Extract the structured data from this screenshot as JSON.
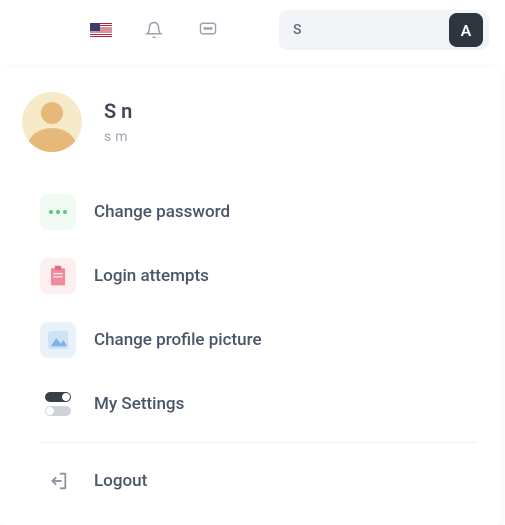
{
  "topbar": {
    "short_name": "S",
    "avatar_initial": "A"
  },
  "profile": {
    "fullname_display": "S                          n",
    "email_display": "s                                                m"
  },
  "menu": {
    "change_password": "Change password",
    "login_attempts": "Login attempts",
    "change_picture": "Change profile picture",
    "my_settings": "My Settings",
    "logout": "Logout"
  }
}
